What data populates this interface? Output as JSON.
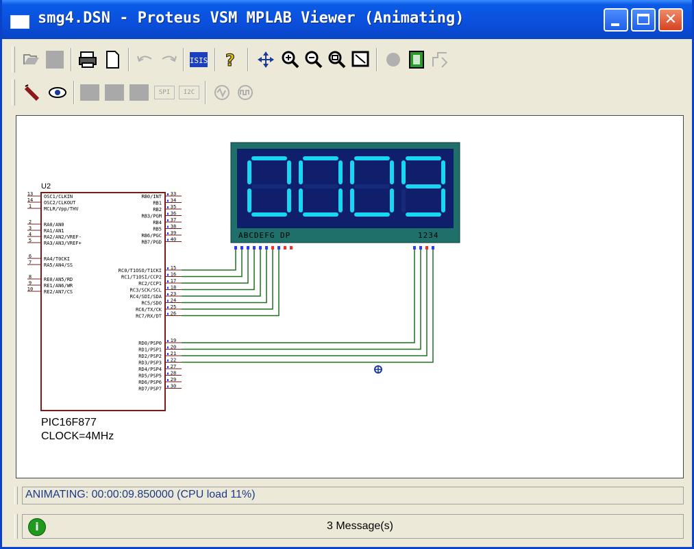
{
  "window": {
    "title": "smg4.DSN - Proteus VSM MPLAB Viewer (Animating)"
  },
  "canvas": {
    "ic": {
      "ref": "U2",
      "part": "PIC16F877",
      "clock": "CLOCK=4MHz",
      "left_pins": [
        {
          "num": "13",
          "name": "OSC1/CLKIN"
        },
        {
          "num": "14",
          "name": "OSC2/CLKOUT"
        },
        {
          "num": "1",
          "name": "MCLR/Vpp/THV"
        },
        {
          "num": "2",
          "name": "RA0/AN0"
        },
        {
          "num": "3",
          "name": "RA1/AN1"
        },
        {
          "num": "4",
          "name": "RA2/AN2/VREF-"
        },
        {
          "num": "5",
          "name": "RA3/AN3/VREF+"
        },
        {
          "num": "6",
          "name": "RA4/T0CKI"
        },
        {
          "num": "7",
          "name": "RA5/AN4/SS"
        },
        {
          "num": "8",
          "name": "RE0/AN5/RD"
        },
        {
          "num": "9",
          "name": "RE1/AN6/WR"
        },
        {
          "num": "10",
          "name": "RE2/AN7/CS"
        }
      ],
      "right_pins_b": [
        {
          "num": "33",
          "name": "RB0/INT"
        },
        {
          "num": "34",
          "name": "RB1"
        },
        {
          "num": "35",
          "name": "RB2"
        },
        {
          "num": "36",
          "name": "RB3/PGM"
        },
        {
          "num": "37",
          "name": "RB4"
        },
        {
          "num": "38",
          "name": "RB5"
        },
        {
          "num": "39",
          "name": "RB6/PGC"
        },
        {
          "num": "40",
          "name": "RB7/PGD"
        }
      ],
      "right_pins_c": [
        {
          "num": "15",
          "name": "RC0/T1OSO/T1CKI"
        },
        {
          "num": "16",
          "name": "RC1/T1OSI/CCP2"
        },
        {
          "num": "17",
          "name": "RC2/CCP1"
        },
        {
          "num": "18",
          "name": "RC3/SCK/SCL"
        },
        {
          "num": "23",
          "name": "RC4/SDI/SDA"
        },
        {
          "num": "24",
          "name": "RC5/SDO"
        },
        {
          "num": "25",
          "name": "RC6/TX/CK"
        },
        {
          "num": "26",
          "name": "RC7/RX/DT"
        }
      ],
      "right_pins_d": [
        {
          "num": "19",
          "name": "RD0/PSP0"
        },
        {
          "num": "20",
          "name": "RD1/PSP1"
        },
        {
          "num": "21",
          "name": "RD2/PSP2"
        },
        {
          "num": "22",
          "name": "RD3/PSP3"
        },
        {
          "num": "27",
          "name": "RD4/PSP4"
        },
        {
          "num": "28",
          "name": "RD5/PSP5"
        },
        {
          "num": "29",
          "name": "RD6/PSP6"
        },
        {
          "num": "30",
          "name": "RD7/PSP7"
        }
      ]
    },
    "display": {
      "digits": "0009",
      "segment_labels": "ABCDEFG DP",
      "digit_labels": "1234",
      "bg_color": "#0f1f6b",
      "frame_color": "#1f6f6a",
      "segment_color": "#19d6f2"
    }
  },
  "status": {
    "animating": "ANIMATING: 00:00:09.850000 (CPU load 11%)",
    "messages": "3 Message(s)"
  },
  "toolbar1": [
    "open-icon",
    "save-icon",
    "print-icon",
    "page-icon",
    "undo-icon",
    "redo-icon",
    "isis-icon",
    "help-icon",
    "pan-icon",
    "zoom-in-icon",
    "zoom-out-icon",
    "zoom-all-icon",
    "zoom-area-icon",
    "blob-icon",
    "animate-icon",
    "step-icon"
  ],
  "toolbar2": {
    "icons": [
      "probe-icon",
      "watch-icon",
      "gray1-icon",
      "gray2-icon",
      "gray3-icon",
      "oscilloscope-icon",
      "logic-analyzer-icon"
    ],
    "spi_label": "SPI",
    "i2c_label": "I2C"
  }
}
